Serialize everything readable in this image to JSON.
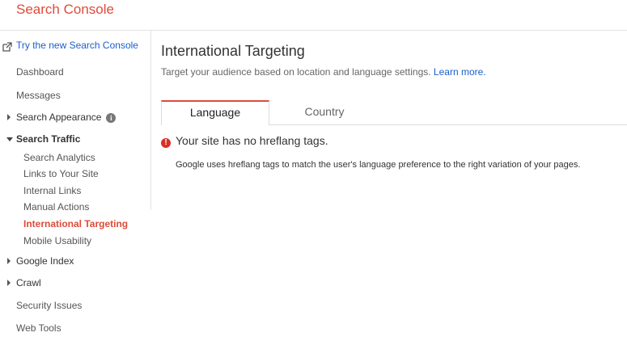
{
  "header": {
    "brand": "Search Console"
  },
  "sidebar": {
    "new_console_link": "Try the new Search Console",
    "items": [
      {
        "label": "Dashboard"
      },
      {
        "label": "Messages"
      },
      {
        "label": "Search Appearance"
      },
      {
        "label": "Search Traffic"
      },
      {
        "label": "Google Index"
      },
      {
        "label": "Crawl"
      },
      {
        "label": "Security Issues"
      },
      {
        "label": "Web Tools"
      }
    ],
    "search_traffic_subitems": [
      {
        "label": "Search Analytics"
      },
      {
        "label": "Links to Your Site"
      },
      {
        "label": "Internal Links"
      },
      {
        "label": "Manual Actions"
      },
      {
        "label": "International Targeting"
      },
      {
        "label": "Mobile Usability"
      }
    ]
  },
  "main": {
    "title": "International Targeting",
    "subtitle": "Target your audience based on location and language settings.",
    "learn_more": "Learn more.",
    "tabs": [
      {
        "label": "Language"
      },
      {
        "label": "Country"
      }
    ],
    "alert": "Your site has no hreflang tags.",
    "description": "Google uses hreflang tags to match the user's language preference to the right variation of your pages."
  },
  "colors": {
    "brand": "#dd4b39",
    "link": "#1a5ecc",
    "alert": "#d93025",
    "active_nav": "#dd4b39"
  }
}
